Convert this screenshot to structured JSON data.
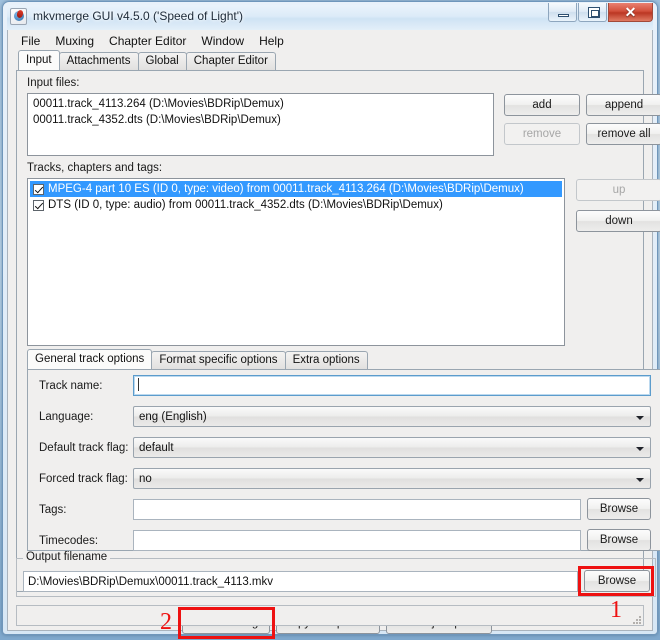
{
  "window": {
    "title": "mkvmerge GUI v4.5.0 ('Speed of Light')",
    "icon": "app-icon",
    "minimize_label": "",
    "maximize_label": "",
    "close_label": "✕",
    "accent_selection": "#3399ff",
    "annotation_color": "#ee1111"
  },
  "menubar": {
    "items": [
      {
        "label": "File"
      },
      {
        "label": "Muxing"
      },
      {
        "label": "Chapter Editor"
      },
      {
        "label": "Window"
      },
      {
        "label": "Help"
      }
    ]
  },
  "tabs": {
    "items": [
      {
        "label": "Input",
        "active": true
      },
      {
        "label": "Attachments",
        "active": false
      },
      {
        "label": "Global",
        "active": false
      },
      {
        "label": "Chapter Editor",
        "active": false
      }
    ]
  },
  "input_files": {
    "label": "Input files:",
    "rows": [
      "00011.track_4113.264 (D:\\Movies\\BDRip\\Demux)",
      "00011.track_4352.dts (D:\\Movies\\BDRip\\Demux)"
    ],
    "buttons": {
      "add": "add",
      "append": "append",
      "remove": "remove",
      "remove_all": "remove all"
    }
  },
  "tracks": {
    "label": "Tracks, chapters and tags:",
    "rows": [
      {
        "checked": true,
        "selected": true,
        "text": "MPEG-4 part 10 ES (ID 0, type: video) from 00011.track_4113.264 (D:\\Movies\\BDRip\\Demux)"
      },
      {
        "checked": true,
        "selected": false,
        "text": "DTS (ID 0, type: audio) from 00011.track_4352.dts (D:\\Movies\\BDRip\\Demux)"
      }
    ],
    "buttons": {
      "up": "up",
      "down": "down"
    }
  },
  "track_tabs": {
    "items": [
      {
        "label": "General track options",
        "active": true
      },
      {
        "label": "Format specific options",
        "active": false
      },
      {
        "label": "Extra options",
        "active": false
      }
    ]
  },
  "track_options": {
    "track_name": {
      "label": "Track name:",
      "value": "",
      "placeholder": ""
    },
    "language": {
      "label": "Language:",
      "value": "eng (English)"
    },
    "default_track_flag": {
      "label": "Default track flag:",
      "value": "default"
    },
    "forced_track_flag": {
      "label": "Forced track flag:",
      "value": "no"
    },
    "tags": {
      "label": "Tags:",
      "value": "",
      "browse": "Browse"
    },
    "timecodes": {
      "label": "Timecodes:",
      "value": "",
      "browse": "Browse"
    }
  },
  "output": {
    "legend": "Output filename",
    "value": "D:\\Movies\\BDRip\\Demux\\00011.track_4113.mkv",
    "browse": "Browse"
  },
  "action_buttons": {
    "start_muxing": "Start muxing",
    "copy_to_clipboard": "Copy to clipboard",
    "add_to_job_queue": "Add to job queue"
  },
  "annotations": {
    "marker_one": "1",
    "marker_two": "2"
  },
  "statusbar": {
    "text": ""
  }
}
